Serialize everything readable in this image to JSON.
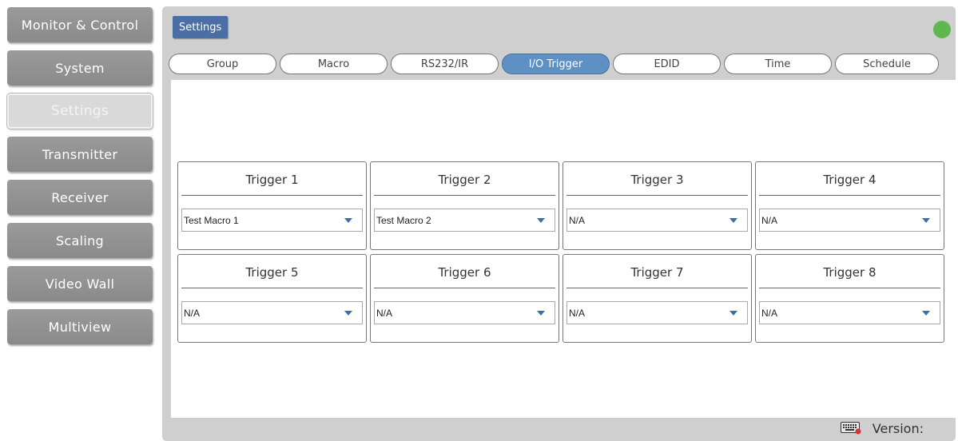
{
  "sidebar": {
    "items": [
      {
        "label": "Monitor & Control",
        "active": false
      },
      {
        "label": "System",
        "active": false
      },
      {
        "label": "Settings",
        "active": true
      },
      {
        "label": "Transmitter",
        "active": false
      },
      {
        "label": "Receiver",
        "active": false
      },
      {
        "label": "Scaling",
        "active": false
      },
      {
        "label": "Video Wall",
        "active": false
      },
      {
        "label": "Multiview",
        "active": false
      }
    ]
  },
  "header": {
    "title": "Settings",
    "status_color": "#5fb84f"
  },
  "tabs": [
    {
      "label": "Group",
      "active": false
    },
    {
      "label": "Macro",
      "active": false
    },
    {
      "label": "RS232/IR",
      "active": false
    },
    {
      "label": "I/O Trigger",
      "active": true
    },
    {
      "label": "EDID",
      "active": false
    },
    {
      "label": "Time",
      "active": false
    },
    {
      "label": "Schedule",
      "active": false
    }
  ],
  "triggers": [
    {
      "title": "Trigger 1",
      "value": "Test Macro 1"
    },
    {
      "title": "Trigger 2",
      "value": "Test Macro 2"
    },
    {
      "title": "Trigger 3",
      "value": "N/A"
    },
    {
      "title": "Trigger 4",
      "value": "N/A"
    },
    {
      "title": "Trigger 5",
      "value": "N/A"
    },
    {
      "title": "Trigger 6",
      "value": "N/A"
    },
    {
      "title": "Trigger 7",
      "value": "N/A"
    },
    {
      "title": "Trigger 8",
      "value": "N/A"
    }
  ],
  "footer": {
    "version_label": "Version:",
    "icon": "keyboard-icon"
  },
  "colors": {
    "accent": "#5e90c4",
    "title_badge": "#4b6fa5",
    "sidebar_button": "#8f8f8f",
    "panel": "#cfcfcf"
  }
}
